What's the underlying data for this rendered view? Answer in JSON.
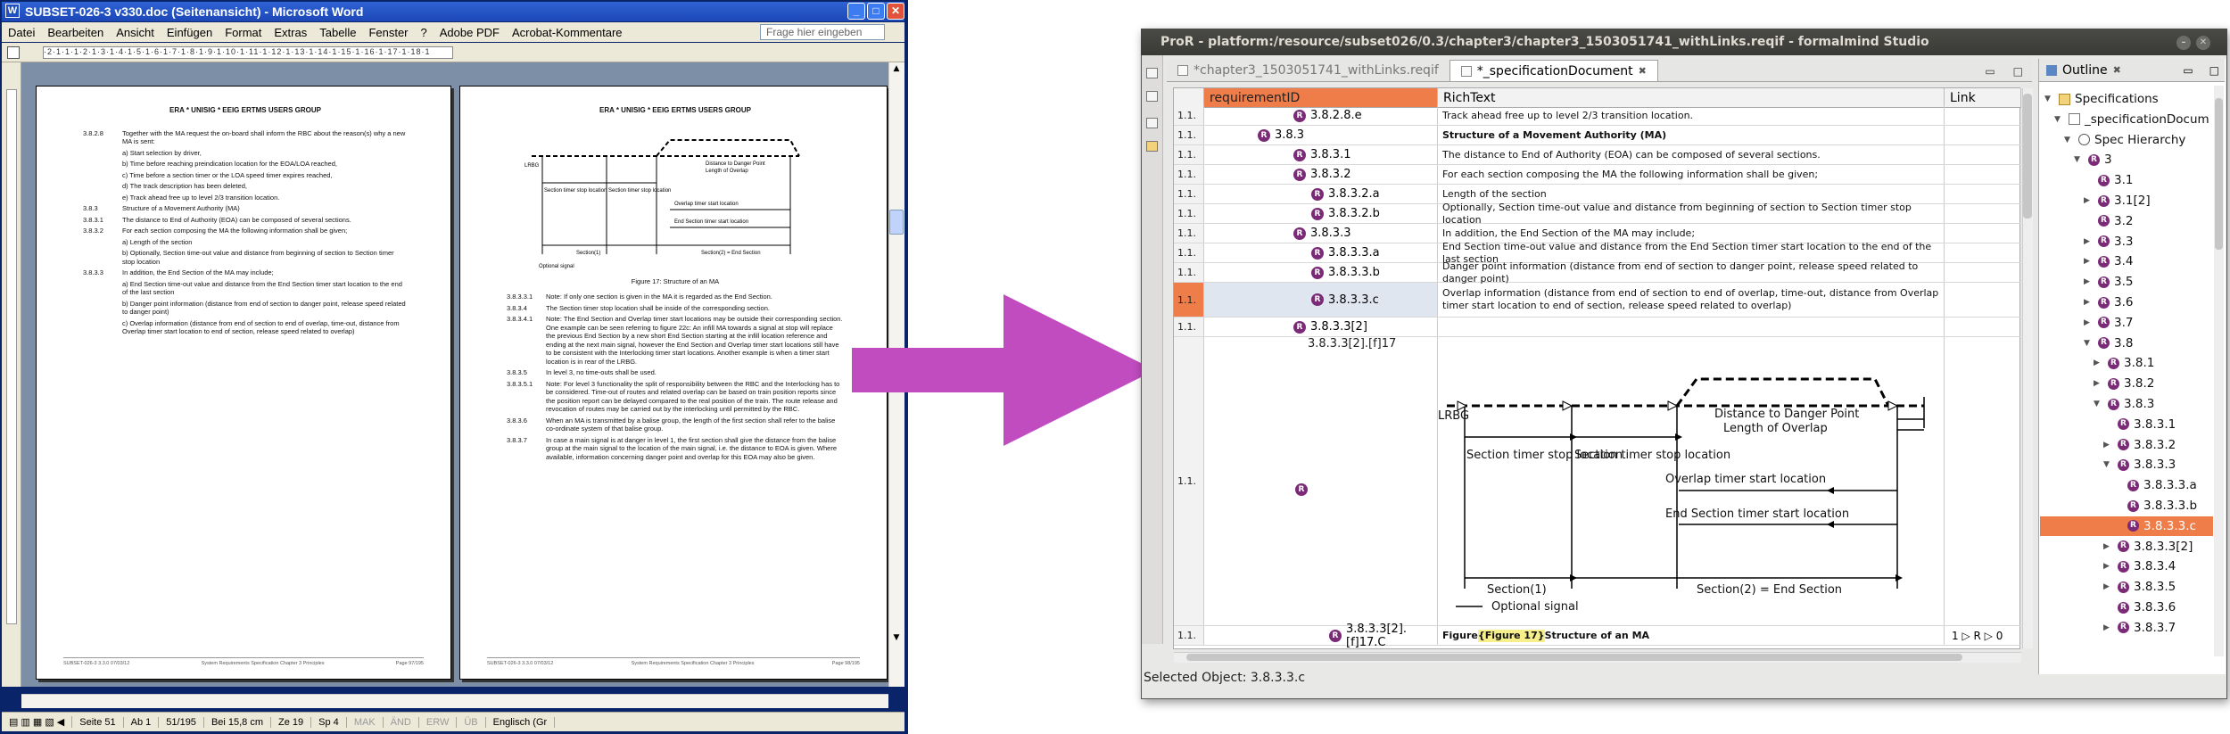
{
  "word": {
    "title": "SUBSET-026-3 v330.doc (Seitenansicht) - Microsoft Word",
    "menu": [
      "Datei",
      "Bearbeiten",
      "Ansicht",
      "Einfügen",
      "Format",
      "Extras",
      "Tabelle",
      "Fenster",
      "?",
      "Adobe PDF",
      "Acrobat-Kommentare"
    ],
    "help_placeholder": "Frage hier eingeben",
    "ruler_text": "·2·1·1·1·2·1·3·1·4·1·5·1·6·1·7·1·8·1·9·1·10·1·11·1·12·1·13·1·14·1·15·1·16·1·17·1·18·1",
    "page1": {
      "header": "ERA * UNISIG * EEIG ERTMS USERS GROUP",
      "items": [
        {
          "num": "3.8.2.8",
          "text": "Together with the MA request the on-board shall inform the RBC about the reason(s) why a new MA is sent:"
        },
        {
          "num": "",
          "text": "a) Start selection by driver,"
        },
        {
          "num": "",
          "text": "b) Time before reaching preindication location for the EOA/LOA reached,"
        },
        {
          "num": "",
          "text": "c) Time before a section timer or the LOA speed timer expires reached,"
        },
        {
          "num": "",
          "text": "d) The track description has been deleted,"
        },
        {
          "num": "",
          "text": "e) Track ahead free up to level 2/3 transition location."
        },
        {
          "num": "3.8.3",
          "text": "Structure of a Movement Authority (MA)"
        },
        {
          "num": "3.8.3.1",
          "text": "The distance to End of Authority (EOA) can be composed of several sections."
        },
        {
          "num": "3.8.3.2",
          "text": "For each section composing the MA the following information shall be given;"
        },
        {
          "num": "",
          "text": "a) Length of the section"
        },
        {
          "num": "",
          "text": "b) Optionally, Section time-out value and distance from beginning of section to Section timer stop location"
        },
        {
          "num": "3.8.3.3",
          "text": "In addition, the End Section of the MA may include;"
        },
        {
          "num": "",
          "text": "a) End Section time-out value and distance from the End Section timer start location to the end of the last section"
        },
        {
          "num": "",
          "text": "b) Danger point information (distance from end of section to danger point, release speed related to danger point)"
        },
        {
          "num": "",
          "text": "c) Overlap information (distance from end of section to end of overlap, time-out, distance from Overlap timer start location to end of section, release speed related to overlap)"
        }
      ],
      "footer": [
        "SUBSET-026-3 3.3.0 07/03/12",
        "System Requirements Specification Chapter 3 Principles",
        "Page 97/195"
      ]
    },
    "page2": {
      "header": "ERA * UNISIG * EEIG ERTMS USERS GROUP",
      "caption": "Figure 17: Structure of an MA",
      "items": [
        {
          "num": "3.8.3.3.1",
          "text": "Note: If only one section is given in the MA it is regarded as the End Section."
        },
        {
          "num": "3.8.3.4",
          "text": "The Section timer stop location shall be inside of the corresponding section."
        },
        {
          "num": "3.8.3.4.1",
          "text": "Note: The End Section and Overlap timer start locations may be outside their corresponding section. One example can be seen referring to figure 22c: An infill MA towards a signal at stop will replace the previous End Section by a new short End Section starting at the infill location reference and ending at the next main signal, however the End Section and Overlap timer start locations still have to be consistent with the Interlocking timer start locations. Another example is when a timer start location is in rear of the LRBG."
        },
        {
          "num": "3.8.3.5",
          "text": "In level 3, no time-outs shall be used."
        },
        {
          "num": "3.8.3.5.1",
          "text": "Note: For level 3 functionality the split of responsibility between the RBC and the Interlocking has to be considered. Time-out of routes and related overlap can be based on train position reports since the position report can be delayed compared to the real position of the train. The route release and revocation of routes may be carried out by the interlocking until permitted by the RBC."
        },
        {
          "num": "3.8.3.6",
          "text": "When an MA is transmitted by a balise group, the length of the first section shall refer to the balise co-ordinate system of that balise group."
        },
        {
          "num": "3.8.3.7",
          "text": "In case a main signal is at danger in level 1, the first section shall give the distance from the balise group at the main signal to the location of the main signal, i.e. the distance to EOA is given. Where available, information concerning danger point and overlap for this EOA may also be given."
        }
      ],
      "footer": [
        "SUBSET-026-3 3.3.0 07/03/12",
        "System Requirements Specification Chapter 3 Principles",
        "Page 98/195"
      ]
    },
    "status": [
      "Seite 51",
      "Ab 1",
      "51/195",
      "Bei 15,8 cm",
      "Ze 19",
      "Sp 4",
      "MAK",
      "ÄND",
      "ERW",
      "ÜB",
      "Englisch (Gr"
    ]
  },
  "pror": {
    "title": "ProR - platform:/resource/subset026/0.3/chapter3/chapter3_1503051741_withLinks.reqif - formalmind Studio",
    "tabs": [
      "*chapter3_1503051741_withLinks.reqif",
      "*_specificationDocument"
    ],
    "columns": [
      "",
      "requirementID",
      "RichText",
      "Link"
    ],
    "rows": [
      {
        "idx": "1.1.",
        "id": "3.8.2.8.e",
        "text": "Track ahead free up to level 2/3 transition location."
      },
      {
        "idx": "1.1.",
        "id": "3.8.3",
        "text": "Structure of a Movement Authority (MA)"
      },
      {
        "idx": "1.1.",
        "id": "3.8.3.1",
        "text": "The distance to End of Authority (EOA) can be composed of several sections."
      },
      {
        "idx": "1.1.",
        "id": "3.8.3.2",
        "text": "For each section composing the MA the following information shall be given;"
      },
      {
        "idx": "1.1.",
        "id": "3.8.3.2.a",
        "text": "Length of the section"
      },
      {
        "idx": "1.1.",
        "id": "3.8.3.2.b",
        "text": "Optionally, Section time-out value and distance from beginning of section to Section timer stop location"
      },
      {
        "idx": "1.1.",
        "id": "3.8.3.3",
        "text": "In addition, the End Section of the MA may include;"
      },
      {
        "idx": "1.1.",
        "id": "3.8.3.3.a",
        "text": "End Section time-out value and distance from the End Section timer start location to the end of the last section"
      },
      {
        "idx": "1.1.",
        "id": "3.8.3.3.b",
        "text": "Danger point information (distance from end of section to danger point, release speed related to danger point)"
      },
      {
        "idx": "1.1.",
        "id": "3.8.3.3.c",
        "text": "Overlap information (distance from end of section to end of overlap, time-out, distance from Overlap timer start location to end of section, release speed related to overlap)"
      },
      {
        "idx": "1.1.",
        "id": "3.8.3.3[2]",
        "text": ""
      },
      {
        "idx": "1.1.",
        "id": "",
        "text": ""
      },
      {
        "idx": "1.1.",
        "id": "3.8.3.3[2].[f]17.C",
        "text": "Structure of an MA",
        "prefix": "Figure ",
        "hl": "{Figure 17}",
        "link": "1 ▷ R ▷ 0"
      }
    ],
    "figure_row_label": "3.8.3.3[2].[f]17",
    "figure": {
      "lrbg": "LRBG",
      "danger": "Distance to Danger Point",
      "overlap_len": "Length of Overlap",
      "stop1": "Section timer stop location",
      "stop2": "Section timer stop location",
      "ovl_timer": "Overlap timer start location",
      "end_timer": "End Section timer start location",
      "sec1": "Section(1)",
      "sec2": "Section(2) = End Section",
      "optional": "Optional signal"
    },
    "status": "Selected Object: 3.8.3.3.c",
    "outline": {
      "title": "Outline",
      "items": [
        {
          "label": "Specifications",
          "level": 0,
          "tw": "▼",
          "icon": "folder"
        },
        {
          "label": "_specificationDocum",
          "level": 1,
          "tw": "▼",
          "icon": "doc"
        },
        {
          "label": "Spec Hierarchy",
          "level": 2,
          "tw": "▼",
          "icon": "circle"
        },
        {
          "label": "3",
          "level": 3,
          "tw": "▼",
          "icon": "r"
        },
        {
          "label": "3.1",
          "level": 4,
          "tw": "",
          "icon": "r"
        },
        {
          "label": "3.1[2]",
          "level": 4,
          "tw": "▶",
          "icon": "r"
        },
        {
          "label": "3.2",
          "level": 4,
          "tw": "",
          "icon": "r"
        },
        {
          "label": "3.3",
          "level": 4,
          "tw": "▶",
          "icon": "r"
        },
        {
          "label": "3.4",
          "level": 4,
          "tw": "▶",
          "icon": "r"
        },
        {
          "label": "3.5",
          "level": 4,
          "tw": "▶",
          "icon": "r"
        },
        {
          "label": "3.6",
          "level": 4,
          "tw": "▶",
          "icon": "r"
        },
        {
          "label": "3.7",
          "level": 4,
          "tw": "▶",
          "icon": "r"
        },
        {
          "label": "3.8",
          "level": 4,
          "tw": "▼",
          "icon": "r"
        },
        {
          "label": "3.8.1",
          "level": 5,
          "tw": "▶",
          "icon": "r"
        },
        {
          "label": "3.8.2",
          "level": 5,
          "tw": "▶",
          "icon": "r"
        },
        {
          "label": "3.8.3",
          "level": 5,
          "tw": "▼",
          "icon": "r"
        },
        {
          "label": "3.8.3.1",
          "level": 6,
          "tw": "",
          "icon": "r"
        },
        {
          "label": "3.8.3.2",
          "level": 6,
          "tw": "▶",
          "icon": "r"
        },
        {
          "label": "3.8.3.3",
          "level": 6,
          "tw": "▼",
          "icon": "r"
        },
        {
          "label": "3.8.3.3.a",
          "level": 7,
          "tw": "",
          "icon": "r"
        },
        {
          "label": "3.8.3.3.b",
          "level": 7,
          "tw": "",
          "icon": "r"
        },
        {
          "label": "3.8.3.3.c",
          "level": 7,
          "tw": "",
          "icon": "r",
          "selected": true
        },
        {
          "label": "3.8.3.3[2]",
          "level": 6,
          "tw": "▶",
          "icon": "r"
        },
        {
          "label": "3.8.3.4",
          "level": 6,
          "tw": "▶",
          "icon": "r"
        },
        {
          "label": "3.8.3.5",
          "level": 6,
          "tw": "▶",
          "icon": "r"
        },
        {
          "label": "3.8.3.6",
          "level": 6,
          "tw": "",
          "icon": "r"
        },
        {
          "label": "3.8.3.7",
          "level": 6,
          "tw": "▶",
          "icon": "r"
        }
      ]
    }
  },
  "colors": {
    "accent": "#ee7d4a",
    "badge": "#7a2a76",
    "arrow": "#c04cc0",
    "word_title": "#1c47b7"
  }
}
